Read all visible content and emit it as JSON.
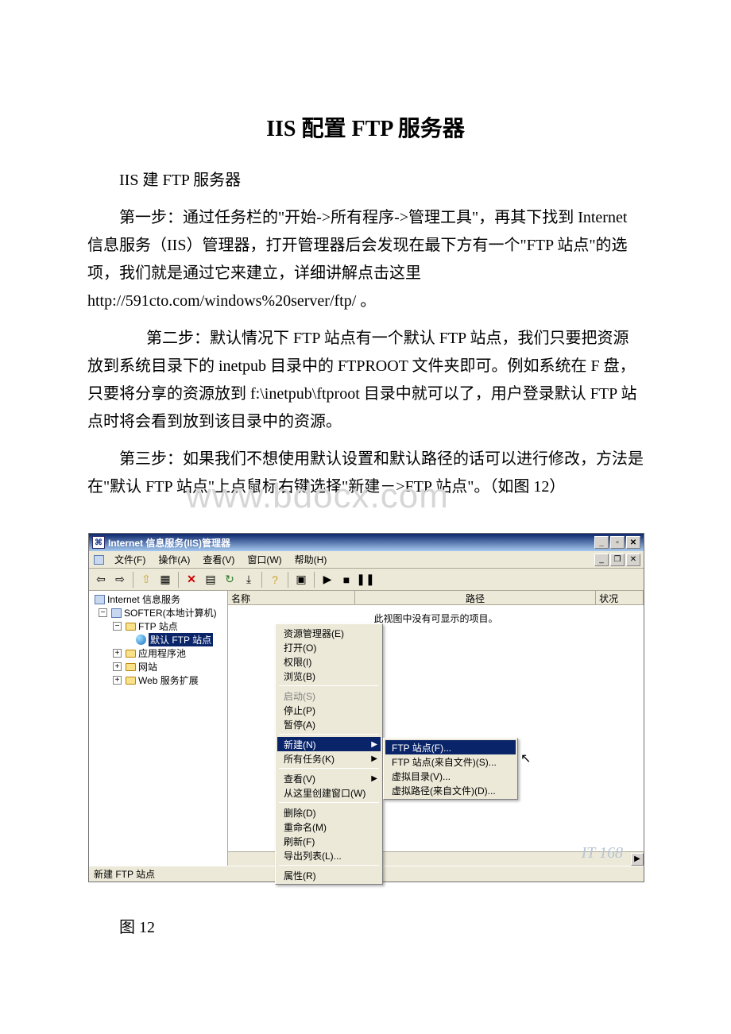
{
  "doc": {
    "title": "IIS 配置 FTP 服务器",
    "intro": "IIS 建 FTP 服务器",
    "p1": "第一步：通过任务栏的\"开始->所有程序->管理工具\"，再其下找到 Internet 信息服务（IIS）管理器，打开管理器后会发现在最下方有一个\"FTP 站点\"的选项，我们就是通过它来建立，详细讲解点击这里 http://591cto.com/windows%20server/ftp/ 。",
    "p2": "第二步：默认情况下 FTP 站点有一个默认 FTP 站点，我们只要把资源放到系统目录下的 inetpub 目录中的 FTPROOT 文件夹即可。例如系统在 F 盘，只要将分享的资源放到 f:\\inetpub\\ftproot 目录中就可以了，用户登录默认 FTP 站点时将会看到放到该目录中的资源。",
    "p3": "第三步：如果我们不想使用默认设置和默认路径的话可以进行修改，方法是在\"默认 FTP 站点\"上点鼠标右键选择\"新建－>FTP 站点\"。（如图 12）",
    "caption": "图 12",
    "watermark": "www.bdocx.com"
  },
  "win": {
    "title": "Internet 信息服务(IIS)管理器",
    "menus": {
      "file": "文件(F)",
      "action": "操作(A)",
      "view": "查看(V)",
      "window": "窗口(W)",
      "help": "帮助(H)"
    },
    "tree": {
      "root": "Internet 信息服务",
      "host": "SOFTER(本地计算机)",
      "ftp_sites": "FTP 站点",
      "default_ftp": "默认 FTP 站点",
      "app_pool": "应用程序池",
      "websites": "网站",
      "web_ext": "Web 服务扩展"
    },
    "list": {
      "col_name": "名称",
      "col_path": "路径",
      "col_status": "状况",
      "empty": "此视图中没有可显示的项目。"
    },
    "statusbar": "新建 FTP 站点",
    "watermark": "IT 168"
  },
  "ctx": {
    "items": [
      {
        "label": "资源管理器(E)",
        "disabled": false
      },
      {
        "label": "打开(O)",
        "disabled": false
      },
      {
        "label": "权限(I)",
        "disabled": false
      },
      {
        "label": "浏览(B)",
        "disabled": false
      }
    ],
    "items2": [
      {
        "label": "启动(S)",
        "disabled": true
      },
      {
        "label": "停止(P)",
        "disabled": false
      },
      {
        "label": "暂停(A)",
        "disabled": false
      }
    ],
    "items3": [
      {
        "label": "新建(N)",
        "hl": true,
        "arrow": true
      },
      {
        "label": "所有任务(K)",
        "arrow": true
      }
    ],
    "items4": [
      {
        "label": "查看(V)",
        "arrow": true
      },
      {
        "label": "从这里创建窗口(W)"
      }
    ],
    "items5": [
      {
        "label": "删除(D)"
      },
      {
        "label": "重命名(M)"
      },
      {
        "label": "刷新(F)"
      },
      {
        "label": "导出列表(L)..."
      }
    ],
    "items6": [
      {
        "label": "属性(R)"
      }
    ]
  },
  "submenu": {
    "items": [
      {
        "label": "FTP 站点(F)...",
        "hl": true
      },
      {
        "label": "FTP 站点(来自文件)(S)..."
      },
      {
        "label": "虚拟目录(V)..."
      },
      {
        "label": "虚拟路径(来自文件)(D)..."
      }
    ]
  }
}
